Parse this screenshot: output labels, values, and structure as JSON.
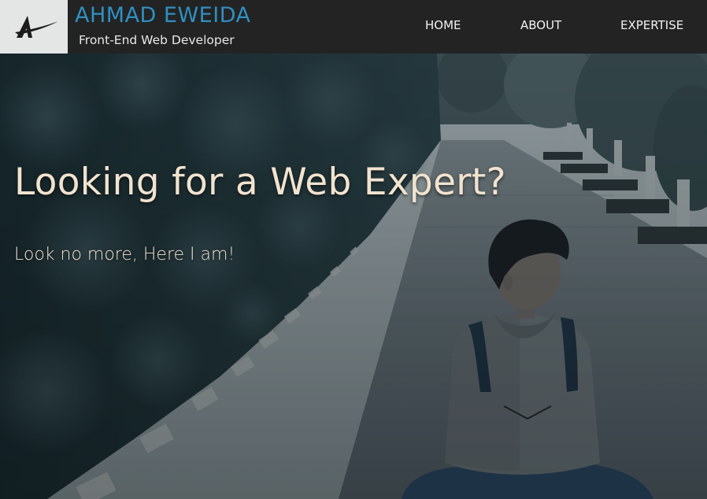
{
  "header": {
    "brand_name": "AHMAD EWEIDA",
    "brand_tagline": "Front-End Web Developer",
    "logo_icon": "ae-logo-icon"
  },
  "nav": {
    "items": [
      {
        "label": "HOME"
      },
      {
        "label": "ABOUT"
      },
      {
        "label": "EXPERTISE"
      }
    ]
  },
  "hero": {
    "title": "Looking for a Web Expert?",
    "subtitle": "Look no more, Here I am!",
    "scroll_icon": "chevron-down-icon"
  },
  "colors": {
    "topbar": "#232323",
    "brand_accent": "#2f8fc0",
    "hero_text": "#f1e3cf",
    "logo_bg": "#e4e6e6"
  }
}
